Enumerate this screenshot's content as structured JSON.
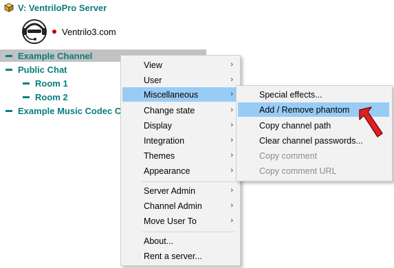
{
  "server": {
    "label": "V: VentriloPro Server",
    "icon": "server-cube-icon"
  },
  "user": {
    "name": "Ventrilo3.com",
    "avatar_icon": "headset-avatar-icon",
    "status_color": "#c00000"
  },
  "channels": [
    {
      "label": "Example Channel",
      "selected": true
    },
    {
      "label": "Public Chat"
    },
    {
      "label": "Room 1"
    },
    {
      "label": "Room 2"
    },
    {
      "label": "Example Music Codec C"
    }
  ],
  "context_menu": {
    "items": [
      {
        "label": "View",
        "submenu": true
      },
      {
        "label": "User",
        "submenu": true
      },
      {
        "label": "Miscellaneous",
        "submenu": true,
        "highlighted": true
      },
      {
        "label": "Change state",
        "submenu": true
      },
      {
        "label": "Display",
        "submenu": true
      },
      {
        "label": "Integration",
        "submenu": true
      },
      {
        "label": "Themes",
        "submenu": true
      },
      {
        "label": "Appearance",
        "submenu": true
      },
      {
        "label": "Server Admin",
        "submenu": true
      },
      {
        "label": "Channel Admin",
        "submenu": true
      },
      {
        "label": "Move User To",
        "submenu": true
      },
      {
        "label": "About..."
      },
      {
        "label": "Rent a server..."
      }
    ],
    "arrow_glyph": "›"
  },
  "submenu": {
    "items": [
      {
        "label": "Special effects..."
      },
      {
        "label": "Add / Remove phantom",
        "highlighted": true
      },
      {
        "label": "Copy channel path"
      },
      {
        "label": "Clear channel passwords..."
      },
      {
        "label": "Copy comment",
        "disabled": true
      },
      {
        "label": "Copy comment URL",
        "disabled": true
      }
    ]
  },
  "colors": {
    "channel_text": "#0a7d7d",
    "highlight": "#99ccf5",
    "selection": "#c2c2c2",
    "pointer_arrow": "#e0201f"
  }
}
